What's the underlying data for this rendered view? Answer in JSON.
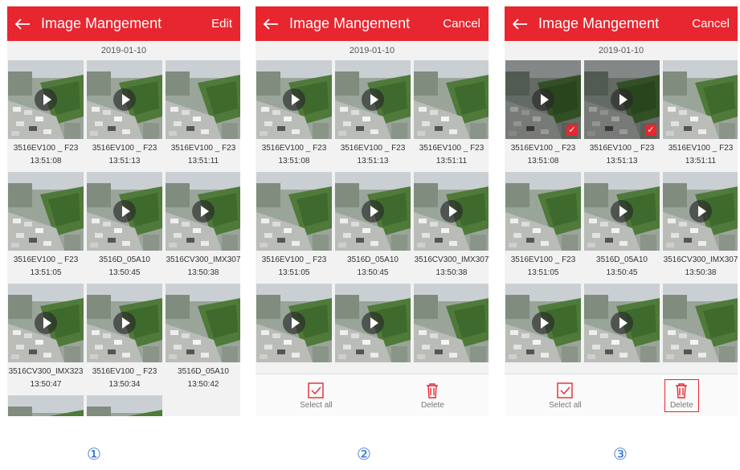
{
  "screens": [
    {
      "header": {
        "title": "Image Mangement",
        "action": "Edit"
      },
      "date": "2019-01-10",
      "items": [
        {
          "name": "3516EV100 _ F23",
          "time": "13:51:08"
        },
        {
          "name": "3516EV100 _ F23",
          "time": "13:51:13"
        },
        {
          "name": "3516EV100 _ F23",
          "time": "13:51:11"
        },
        {
          "name": "3516EV100 _ F23",
          "time": "13:51:05"
        },
        {
          "name": "3516D_05A10",
          "time": "13:50:45"
        },
        {
          "name": "3516CV300_IMX307",
          "time": "13:50:38"
        },
        {
          "name": "3516CV300_IMX323",
          "time": "13:50:47"
        },
        {
          "name": "3516EV100 _ F23",
          "time": "13:50:34"
        },
        {
          "name": "3516D_05A10",
          "time": "13:50:42"
        }
      ],
      "marker": "①"
    },
    {
      "header": {
        "title": "Image Mangement",
        "action": "Cancel"
      },
      "date": "2019-01-10",
      "items": [
        {
          "name": "3516EV100 _ F23",
          "time": "13:51:08"
        },
        {
          "name": "3516EV100 _ F23",
          "time": "13:51:13"
        },
        {
          "name": "3516EV100 _ F23",
          "time": "13:51:11"
        },
        {
          "name": "3516EV100 _ F23",
          "time": "13:51:05"
        },
        {
          "name": "3516D_05A10",
          "time": "13:50:45"
        },
        {
          "name": "3516CV300_IMX307",
          "time": "13:50:38"
        }
      ],
      "bottom": {
        "select_all": "Select all",
        "delete": "Delete"
      },
      "marker": "②"
    },
    {
      "header": {
        "title": "Image Mangement",
        "action": "Cancel"
      },
      "date": "2019-01-10",
      "items": [
        {
          "name": "3516EV100 _ F23",
          "time": "13:51:08"
        },
        {
          "name": "3516EV100 _ F23",
          "time": "13:51:13"
        },
        {
          "name": "3516EV100 _ F23",
          "time": "13:51:11"
        },
        {
          "name": "3516EV100 _ F23",
          "time": "13:51:05"
        },
        {
          "name": "3516D_05A10",
          "time": "13:50:45"
        },
        {
          "name": "3516CV300_IMX307",
          "time": "13:50:38"
        }
      ],
      "bottom": {
        "select_all": "Select all",
        "delete": "Delete"
      },
      "marker": "③"
    }
  ],
  "colors": {
    "brand": "#e8262f",
    "marker": "#2a6fcf"
  }
}
